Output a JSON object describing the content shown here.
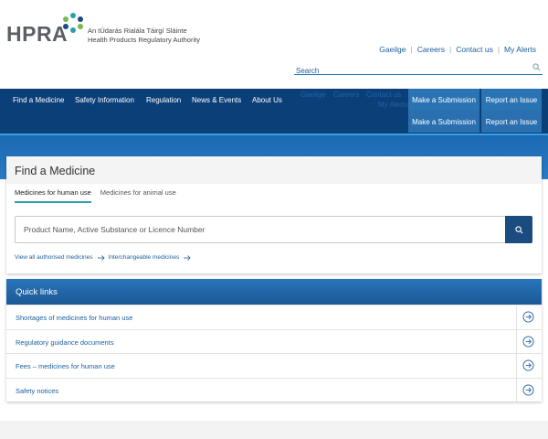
{
  "brand": {
    "wordmark": "HPRA",
    "irish_name": "An tÚdarás Rialála Táirgí Sláinte",
    "english_name": "Health Products Regulatory Authority",
    "colors": {
      "navy": "#0b3f78",
      "blue": "#1a68b1",
      "teal": "#2a9fb0",
      "green": "#7ab648"
    }
  },
  "utility_links": [
    "Gaeilge",
    "Careers",
    "Contact us",
    "My Alerts"
  ],
  "search": {
    "placeholder": "Search",
    "icon": "magnifier-icon"
  },
  "nav": {
    "items": [
      "Find a Medicine",
      "Safety Information",
      "Regulation",
      "News & Events",
      "About Us"
    ],
    "ghost_links": [
      "Gaeilge",
      "Careers",
      "Contact us",
      "My Alerts"
    ],
    "buttons": [
      "Make a Submission",
      "Report an Issue"
    ],
    "buttons_repeat": [
      "Make a Submission",
      "Report an Issue"
    ]
  },
  "find": {
    "title": "Find a Medicine",
    "tabs": [
      "Medicines for human use",
      "Medicines for animal use"
    ],
    "active_tab": "Medicines for human use",
    "input_placeholder": "Product Name, Active Substance or Licence Number",
    "links": [
      "View all authorised medicines",
      "Interchangeable medicines"
    ]
  },
  "quick_links": {
    "title": "Quick links",
    "items": [
      "Shortages of medicines for human use",
      "Regulatory guidance documents",
      "Fees – medicines for human use",
      "Safety notices"
    ]
  }
}
